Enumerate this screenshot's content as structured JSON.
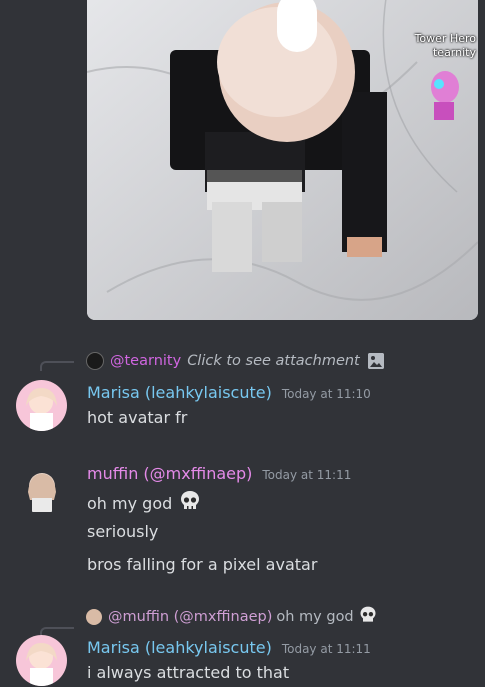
{
  "attachment": {
    "overlay_line1": "Tower Hero",
    "overlay_line2": "tearnity"
  },
  "reply1": {
    "name": "@tearnity",
    "text": "Click to see attachment"
  },
  "message1": {
    "author": "Marisa (leahkylaiscute)",
    "timestamp": "Today at 11:10",
    "lines": [
      "hot avatar fr"
    ],
    "name_color": "#78c8f0"
  },
  "message2": {
    "author": "muffin (@mxffinaep)",
    "timestamp": "Today at 11:11",
    "lines": [
      "oh my god",
      "seriously",
      "bros falling for a pixel avatar"
    ],
    "name_color": "#e48ae8"
  },
  "reply2": {
    "name": "@muffin (@mxffinaep)",
    "text": "oh my god"
  },
  "message3": {
    "author": "Marisa (leahkylaiscute)",
    "timestamp": "Today at 11:11",
    "lines": [
      "i always attracted to that"
    ],
    "name_color": "#78c8f0"
  },
  "icons": {
    "skull": "skull-emoji",
    "image": "image-icon"
  }
}
